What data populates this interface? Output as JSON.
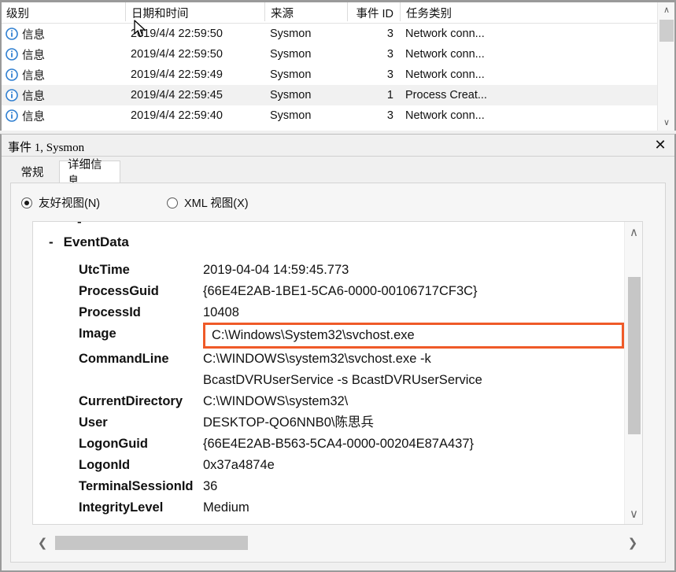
{
  "event_list": {
    "columns": [
      {
        "label": "级别",
        "key": "level"
      },
      {
        "label": "日期和时间",
        "key": "datetime"
      },
      {
        "label": "来源",
        "key": "source"
      },
      {
        "label": "事件 ID",
        "key": "event_id"
      },
      {
        "label": "任务类别",
        "key": "task"
      }
    ],
    "rows": [
      {
        "level": "信息",
        "datetime": "2019/4/4 22:59:50",
        "source": "Sysmon",
        "event_id": "3",
        "task": "Network conn...",
        "icon": "info-icon",
        "selected": false
      },
      {
        "level": "信息",
        "datetime": "2019/4/4 22:59:50",
        "source": "Sysmon",
        "event_id": "3",
        "task": "Network conn...",
        "icon": "info-icon",
        "selected": false
      },
      {
        "level": "信息",
        "datetime": "2019/4/4 22:59:49",
        "source": "Sysmon",
        "event_id": "3",
        "task": "Network conn...",
        "icon": "info-icon",
        "selected": false
      },
      {
        "level": "信息",
        "datetime": "2019/4/4 22:59:45",
        "source": "Sysmon",
        "event_id": "1",
        "task": "Process Creat...",
        "icon": "info-icon",
        "selected": true
      },
      {
        "level": "信息",
        "datetime": "2019/4/4 22:59:40",
        "source": "Sysmon",
        "event_id": "3",
        "task": "Network conn...",
        "icon": "info-icon",
        "selected": false
      }
    ]
  },
  "detail": {
    "title": "事件 1, Sysmon",
    "close_label": "✕",
    "tabs": [
      {
        "label": "常规",
        "active": false
      },
      {
        "label": "详细信息",
        "active": true
      }
    ],
    "view_modes": [
      {
        "label": "友好视图(N)",
        "selected": true
      },
      {
        "label": "XML 视图(X)",
        "selected": false
      }
    ],
    "section_title": "EventData",
    "section_collapse_glyph": "-",
    "fields": [
      {
        "key": "UtcTime",
        "value": "2019-04-04 14:59:45.773",
        "highlight": false
      },
      {
        "key": "ProcessGuid",
        "value": "{66E4E2AB-1BE1-5CA6-0000-00106717CF3C}",
        "highlight": false
      },
      {
        "key": "ProcessId",
        "value": "10408",
        "highlight": false
      },
      {
        "key": "Image",
        "value": "C:\\Windows\\System32\\svchost.exe",
        "highlight": true
      },
      {
        "key": "CommandLine",
        "value": "C:\\WINDOWS\\system32\\svchost.exe -k\nBcastDVRUserService -s BcastDVRUserService",
        "highlight": false
      },
      {
        "key": "CurrentDirectory",
        "value": "C:\\WINDOWS\\system32\\",
        "highlight": false
      },
      {
        "key": "User",
        "value": "DESKTOP-QO6NNB0\\陈思兵",
        "highlight": false
      },
      {
        "key": "LogonGuid",
        "value": "{66E4E2AB-B563-5CA4-0000-00204E87A437}",
        "highlight": false
      },
      {
        "key": "LogonId",
        "value": "0x37a4874e",
        "highlight": false
      },
      {
        "key": "TerminalSessionId",
        "value": "36",
        "highlight": false
      },
      {
        "key": "IntegrityLevel",
        "value": "Medium",
        "highlight": false
      }
    ]
  },
  "scrollbars": {
    "up_glyph": "∧",
    "down_glyph": "∨",
    "left_glyph": "❮",
    "right_glyph": "❯"
  },
  "colors": {
    "highlight_border": "#ef5a28",
    "info_icon": "#2f7fd1",
    "selected_row": "#f1f1f1"
  }
}
